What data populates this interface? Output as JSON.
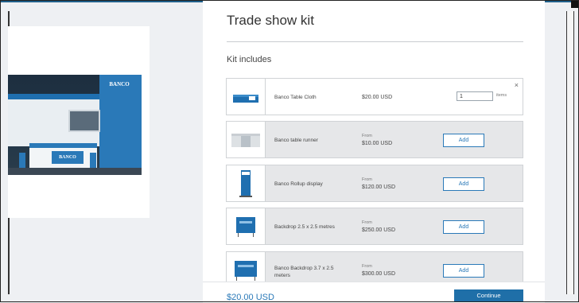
{
  "preview": {
    "brand_tower": "BANCO",
    "brand_counter": "BANCO"
  },
  "kit": {
    "title": "Trade show kit",
    "section_label": "Kit includes",
    "items": [
      {
        "name": "Banco Table Cloth",
        "price_prefix": "",
        "price": "$20.00 USD",
        "quantity": "1",
        "unit": "items",
        "selected": true
      },
      {
        "name": "Banco table runner",
        "price_prefix": "From",
        "price": "$10.00 USD",
        "action": "Add"
      },
      {
        "name": "Banco Rollup display",
        "price_prefix": "From",
        "price": "$120.00 USD",
        "action": "Add"
      },
      {
        "name": "Backdrop 2.5 x 2.5 metres",
        "price_prefix": "From",
        "price": "$250.00 USD",
        "action": "Add"
      },
      {
        "name": "Banco Backdrop 3.7 x 2.5 meters",
        "price_prefix": "From",
        "price": "$300.00 USD",
        "action": "Add"
      }
    ]
  },
  "footer": {
    "total": "$20.00 USD",
    "continue_label": "Continue"
  },
  "close_symbol": "×",
  "colors": {
    "accent": "#2a79b8",
    "primary_button": "#1f6fa8",
    "item_bg": "#e6e7e9"
  }
}
